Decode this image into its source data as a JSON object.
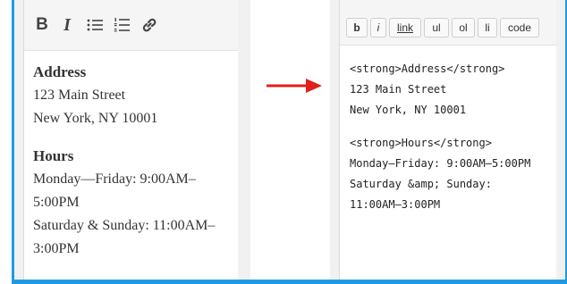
{
  "visual_editor": {
    "toolbar": {
      "bold_label": "B",
      "italic_label": "I",
      "bulleted_list_icon": "bulleted-list-icon",
      "numbered_list_icon": "numbered-list-icon",
      "link_icon": "link-icon"
    },
    "content": {
      "address_heading": "Address",
      "street": "123 Main Street",
      "city": "New York, NY 10001",
      "hours_heading": "Hours",
      "weekday_line1": "Monday—Friday: 9:00AM–",
      "weekday_line2": "5:00PM",
      "weekend_line1": "Saturday & Sunday: 11:00AM–",
      "weekend_line2": "3:00PM"
    }
  },
  "arrow": {
    "color": "#e0201b",
    "icon": "right-arrow-icon"
  },
  "text_editor": {
    "toolbar": {
      "bold": "b",
      "italic": "i",
      "link": "link",
      "ul": "ul",
      "ol": "ol",
      "li": "li",
      "code": "code"
    },
    "content": {
      "line1": "<strong>Address</strong>",
      "line2": "123 Main Street",
      "line3": "New York, NY 10001",
      "line4": "<strong>Hours</strong>",
      "line5": "Monday–Friday: 9:00AM–5:00PM",
      "line6": "Saturday &amp; Sunday:",
      "line7": "11:00AM–3:00PM"
    }
  },
  "colors": {
    "frame": "#1e9be0",
    "toolbar_bg": "#f5f5f5"
  }
}
